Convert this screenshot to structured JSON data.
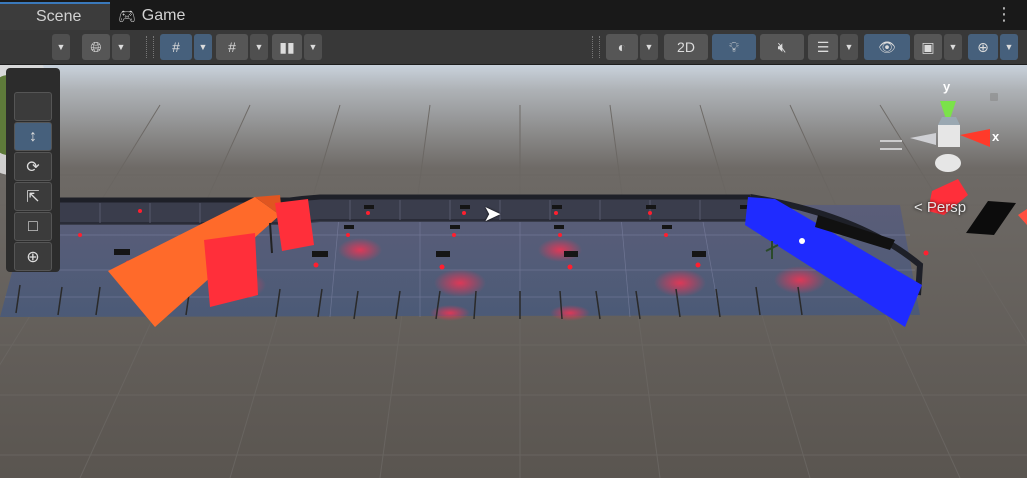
{
  "tabs": {
    "scene": "Scene",
    "game": "Game"
  },
  "toolbar": {
    "two_d": "2D"
  },
  "gizmo": {
    "x": "x",
    "y": "y",
    "persp": "< Persp"
  },
  "colors": {
    "accent": "#46607c",
    "orange_block": "#ff6a2a",
    "red_block": "#ff2f3a",
    "blue_block": "#1f2bff"
  },
  "icons": [
    "globe-icon",
    "grid-snap-icon",
    "snap-increment-icon",
    "ruler-icon",
    "render-mode-icon",
    "light-icon",
    "audio-mute-icon",
    "effects-icon",
    "visibility-icon",
    "camera-icon",
    "gizmo-icon",
    "move-tool-icon",
    "rotate-tool-icon",
    "scale-tool-icon",
    "rect-tool-icon",
    "transform-tool-icon",
    "kebab-menu-icon"
  ]
}
